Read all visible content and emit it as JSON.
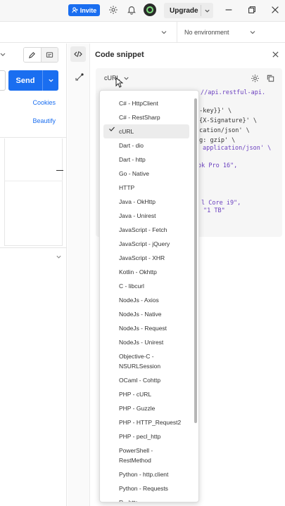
{
  "titlebar": {
    "invite_label": "Invite",
    "upgrade_label": "Upgrade"
  },
  "envbar": {
    "environment_label": "No environment"
  },
  "left_pane": {
    "send_label": "Send",
    "cookies_label": "Cookies",
    "beautify_label": "Beautify"
  },
  "panel": {
    "title": "Code snippet",
    "selected_language": "cURL",
    "code_lines": [
      "//api.restful-api.",
      "i-key}}' \\",
      "[{X-Signature}' \\",
      "ication/json' \\",
      "ng: gzip' \\",
      "application/json' \\",
      "ok Pro 16\",",
      "l Core i9\",",
      "\"1 TB\""
    ]
  },
  "languages": [
    {
      "label": "C# - HttpClient"
    },
    {
      "label": "C# - RestSharp"
    },
    {
      "label": "cURL",
      "selected": true
    },
    {
      "label": "Dart - dio"
    },
    {
      "label": "Dart - http"
    },
    {
      "label": "Go - Native"
    },
    {
      "label": "HTTP"
    },
    {
      "label": "Java - OkHttp"
    },
    {
      "label": "Java - Unirest"
    },
    {
      "label": "JavaScript - Fetch"
    },
    {
      "label": "JavaScript - jQuery"
    },
    {
      "label": "JavaScript - XHR"
    },
    {
      "label": "Kotlin - Okhttp"
    },
    {
      "label": "C - libcurl"
    },
    {
      "label": "NodeJs - Axios"
    },
    {
      "label": "NodeJs - Native"
    },
    {
      "label": "NodeJs - Request"
    },
    {
      "label": "NodeJs - Unirest"
    },
    {
      "label": "Objective-C - NSURLSession"
    },
    {
      "label": "OCaml - Cohttp"
    },
    {
      "label": "PHP - cURL"
    },
    {
      "label": "PHP - Guzzle"
    },
    {
      "label": "PHP - HTTP_Request2"
    },
    {
      "label": "PHP - pecl_http"
    },
    {
      "label": "PowerShell - RestMethod"
    },
    {
      "label": "Python - http.client"
    },
    {
      "label": "Python - Requests"
    },
    {
      "label": "R - httr"
    }
  ],
  "colors": {
    "accent": "#1a6ef0",
    "code_string": "#6a3fbf"
  }
}
